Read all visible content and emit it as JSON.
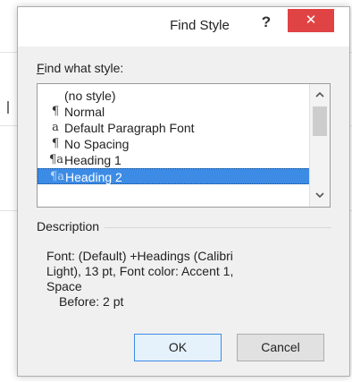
{
  "dialog": {
    "title": "Find Style",
    "help_label": "?",
    "close_label": "✕"
  },
  "find": {
    "label_prefix": "F",
    "label_rest": "ind what style:",
    "items": [
      {
        "glyph": "",
        "label": "(no style)"
      },
      {
        "glyph": "¶",
        "label": "Normal"
      },
      {
        "glyph": "a",
        "label": "Default Paragraph Font"
      },
      {
        "glyph": "¶",
        "label": "No Spacing"
      },
      {
        "glyph": "¶a",
        "label": "Heading 1"
      },
      {
        "glyph": "¶a",
        "label": "Heading 2",
        "selected": true
      }
    ]
  },
  "description": {
    "heading": "Description",
    "lines": [
      "Font: (Default) +Headings (Calibri",
      "Light), 13 pt, Font color: Accent 1,",
      "Space",
      "Before:  2 pt"
    ]
  },
  "buttons": {
    "ok_label": "OK",
    "cancel_label": "Cancel"
  }
}
